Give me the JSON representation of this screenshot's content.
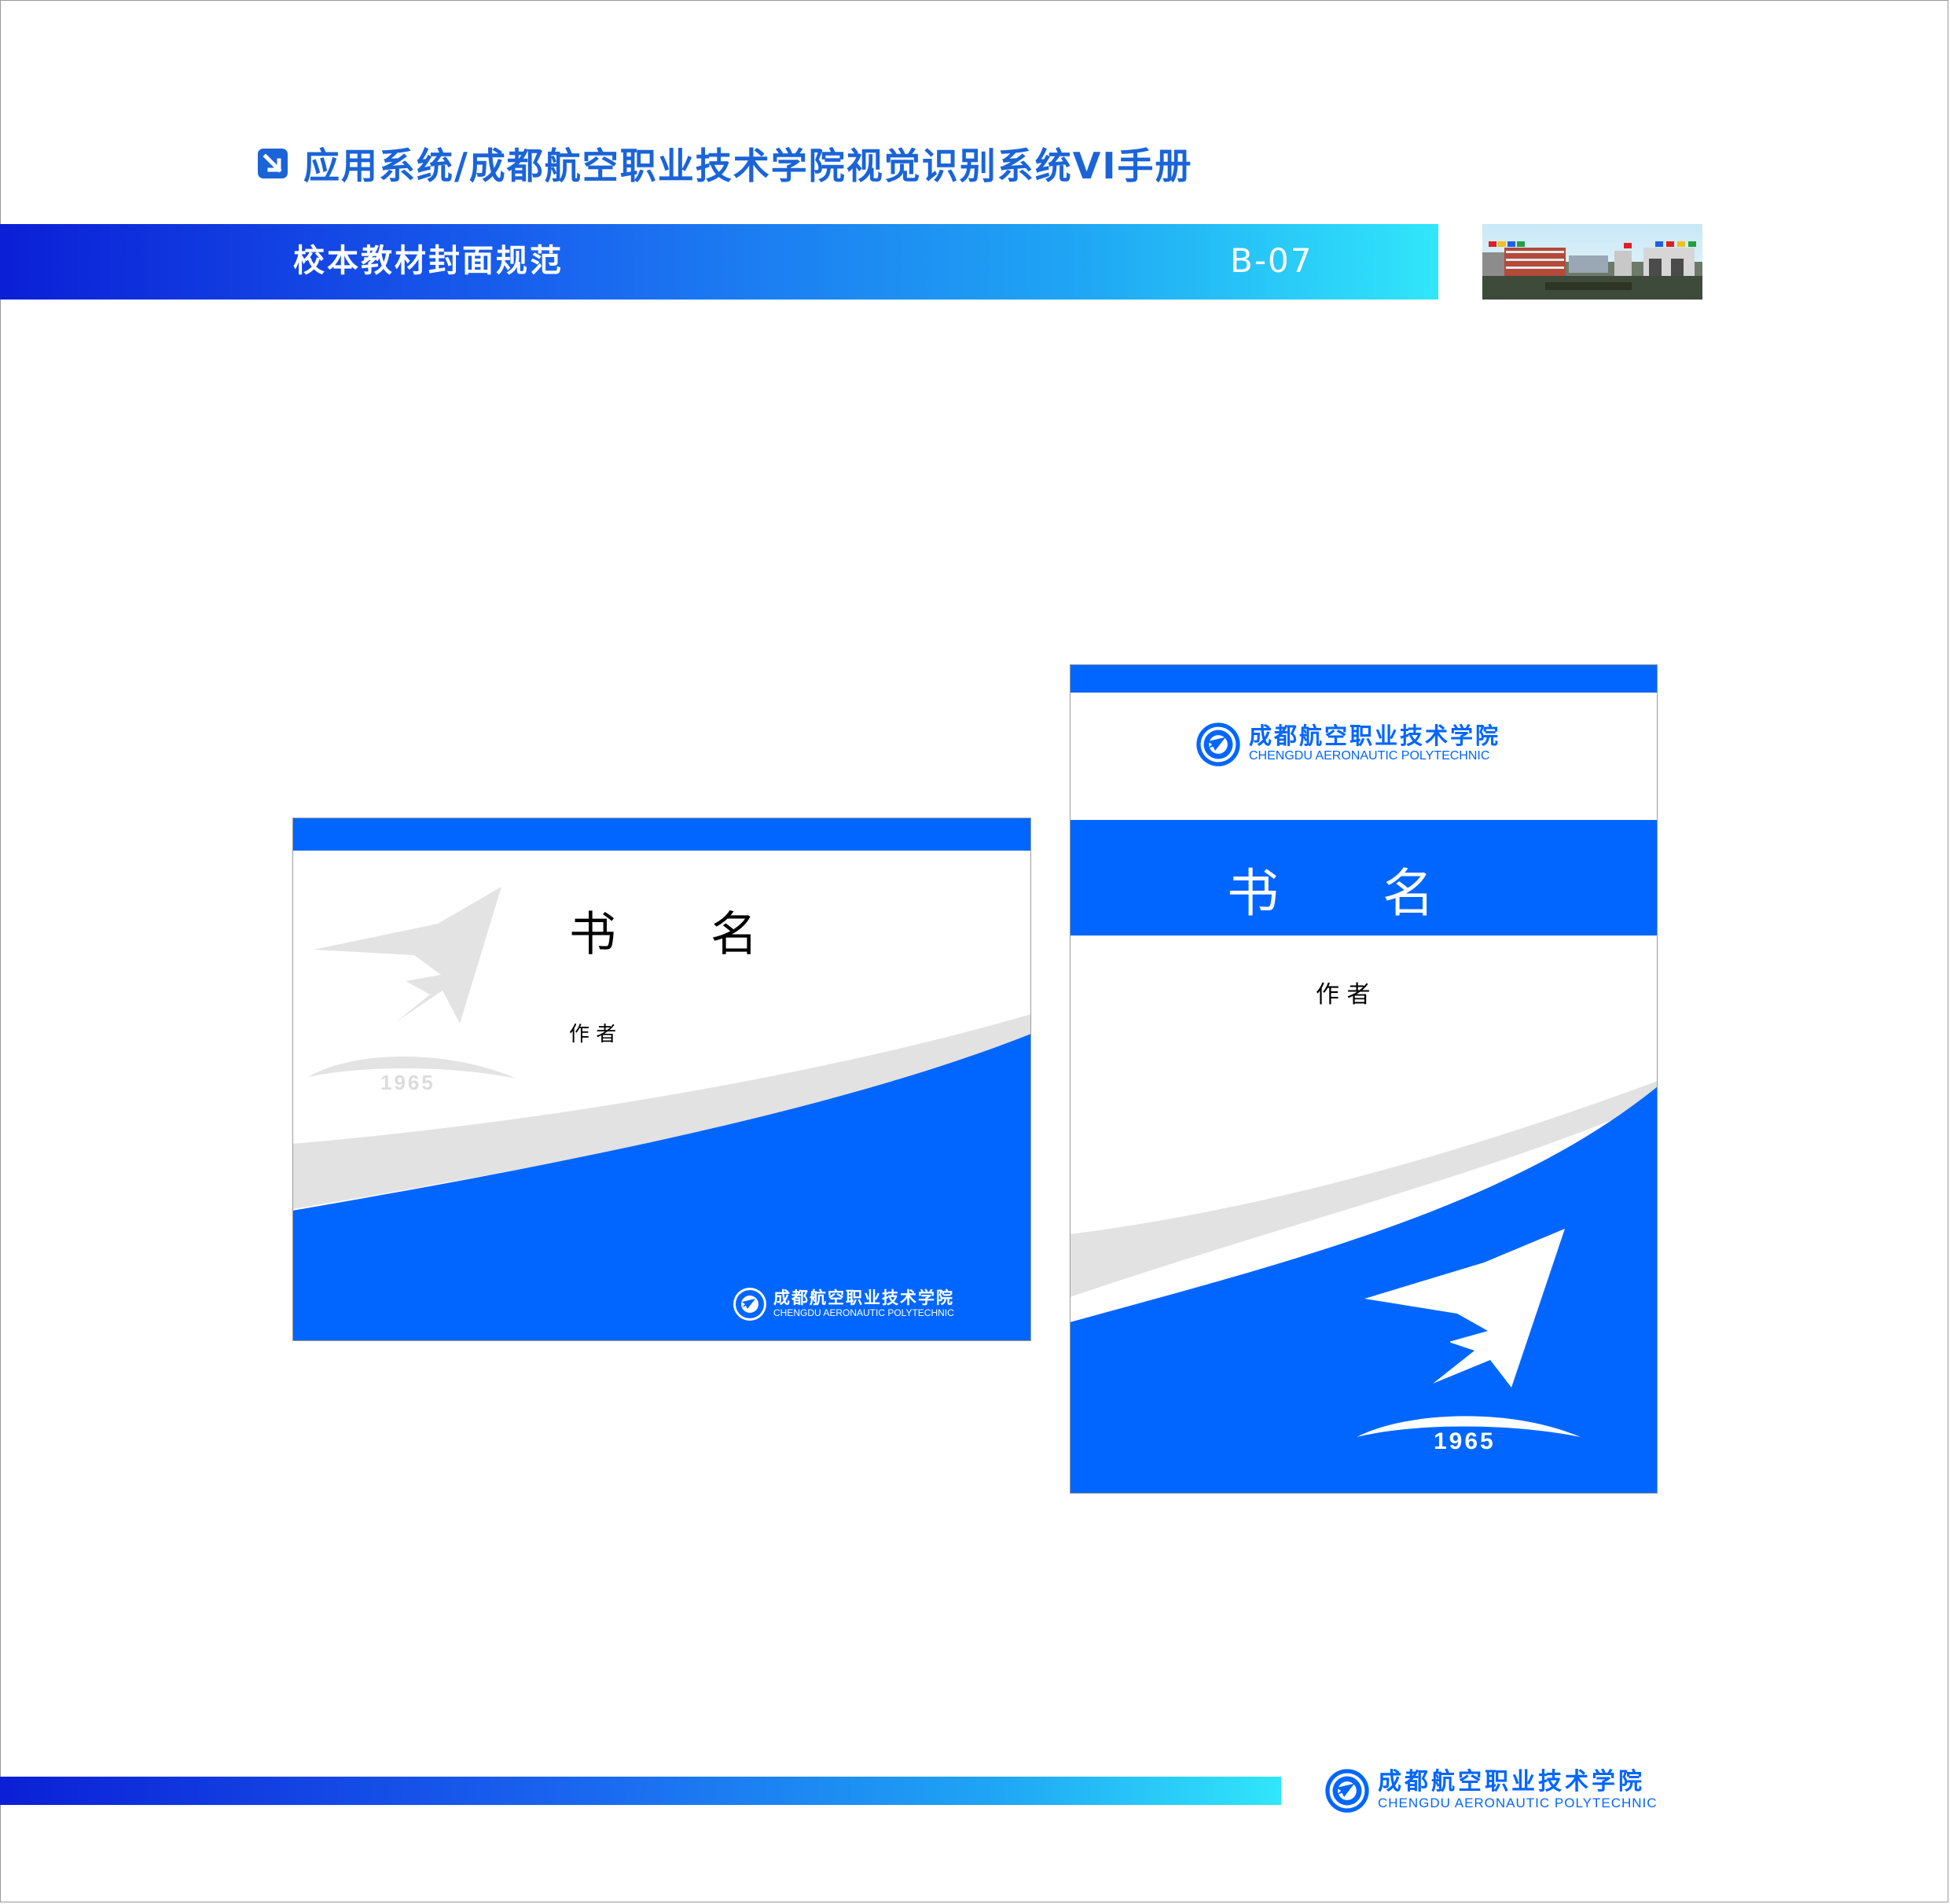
{
  "header": {
    "title": "应用系统/成都航空职业技术学院视觉识别系统VI手册",
    "section_title": "校本教材封面规范",
    "section_code": "B-07"
  },
  "school": {
    "name_cn": "成都航空职业技术学院",
    "name_en": "CHENGDU AERONAUTIC POLYTECHNIC",
    "founded_year": "1965"
  },
  "cover_landscape": {
    "book_title": "书　　名",
    "author_label": "作 者"
  },
  "cover_portrait": {
    "book_title": "书　　名",
    "author_label": "作 者"
  },
  "colors": {
    "brand_blue": "#0066ff",
    "gray_swoosh": "#e2e2e2",
    "header_blue": "#1b64d8"
  }
}
